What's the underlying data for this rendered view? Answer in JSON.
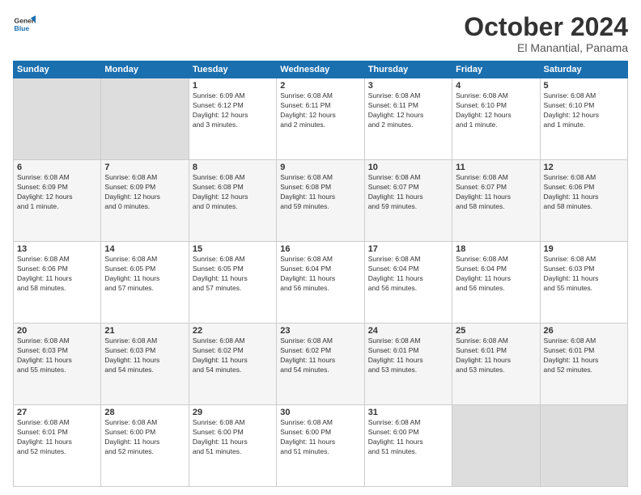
{
  "header": {
    "logo_line1": "General",
    "logo_line2": "Blue",
    "month_title": "October 2024",
    "location": "El Manantial, Panama"
  },
  "calendar": {
    "weekdays": [
      "Sunday",
      "Monday",
      "Tuesday",
      "Wednesday",
      "Thursday",
      "Friday",
      "Saturday"
    ],
    "weeks": [
      [
        {
          "num": "",
          "empty": true
        },
        {
          "num": "",
          "empty": true
        },
        {
          "num": "1",
          "info": "Sunrise: 6:09 AM\nSunset: 6:12 PM\nDaylight: 12 hours\nand 3 minutes."
        },
        {
          "num": "2",
          "info": "Sunrise: 6:08 AM\nSunset: 6:11 PM\nDaylight: 12 hours\nand 2 minutes."
        },
        {
          "num": "3",
          "info": "Sunrise: 6:08 AM\nSunset: 6:11 PM\nDaylight: 12 hours\nand 2 minutes."
        },
        {
          "num": "4",
          "info": "Sunrise: 6:08 AM\nSunset: 6:10 PM\nDaylight: 12 hours\nand 1 minute."
        },
        {
          "num": "5",
          "info": "Sunrise: 6:08 AM\nSunset: 6:10 PM\nDaylight: 12 hours\nand 1 minute."
        }
      ],
      [
        {
          "num": "6",
          "info": "Sunrise: 6:08 AM\nSunset: 6:09 PM\nDaylight: 12 hours\nand 1 minute."
        },
        {
          "num": "7",
          "info": "Sunrise: 6:08 AM\nSunset: 6:09 PM\nDaylight: 12 hours\nand 0 minutes."
        },
        {
          "num": "8",
          "info": "Sunrise: 6:08 AM\nSunset: 6:08 PM\nDaylight: 12 hours\nand 0 minutes."
        },
        {
          "num": "9",
          "info": "Sunrise: 6:08 AM\nSunset: 6:08 PM\nDaylight: 11 hours\nand 59 minutes."
        },
        {
          "num": "10",
          "info": "Sunrise: 6:08 AM\nSunset: 6:07 PM\nDaylight: 11 hours\nand 59 minutes."
        },
        {
          "num": "11",
          "info": "Sunrise: 6:08 AM\nSunset: 6:07 PM\nDaylight: 11 hours\nand 58 minutes."
        },
        {
          "num": "12",
          "info": "Sunrise: 6:08 AM\nSunset: 6:06 PM\nDaylight: 11 hours\nand 58 minutes."
        }
      ],
      [
        {
          "num": "13",
          "info": "Sunrise: 6:08 AM\nSunset: 6:06 PM\nDaylight: 11 hours\nand 58 minutes."
        },
        {
          "num": "14",
          "info": "Sunrise: 6:08 AM\nSunset: 6:05 PM\nDaylight: 11 hours\nand 57 minutes."
        },
        {
          "num": "15",
          "info": "Sunrise: 6:08 AM\nSunset: 6:05 PM\nDaylight: 11 hours\nand 57 minutes."
        },
        {
          "num": "16",
          "info": "Sunrise: 6:08 AM\nSunset: 6:04 PM\nDaylight: 11 hours\nand 56 minutes."
        },
        {
          "num": "17",
          "info": "Sunrise: 6:08 AM\nSunset: 6:04 PM\nDaylight: 11 hours\nand 56 minutes."
        },
        {
          "num": "18",
          "info": "Sunrise: 6:08 AM\nSunset: 6:04 PM\nDaylight: 11 hours\nand 56 minutes."
        },
        {
          "num": "19",
          "info": "Sunrise: 6:08 AM\nSunset: 6:03 PM\nDaylight: 11 hours\nand 55 minutes."
        }
      ],
      [
        {
          "num": "20",
          "info": "Sunrise: 6:08 AM\nSunset: 6:03 PM\nDaylight: 11 hours\nand 55 minutes."
        },
        {
          "num": "21",
          "info": "Sunrise: 6:08 AM\nSunset: 6:03 PM\nDaylight: 11 hours\nand 54 minutes."
        },
        {
          "num": "22",
          "info": "Sunrise: 6:08 AM\nSunset: 6:02 PM\nDaylight: 11 hours\nand 54 minutes."
        },
        {
          "num": "23",
          "info": "Sunrise: 6:08 AM\nSunset: 6:02 PM\nDaylight: 11 hours\nand 54 minutes."
        },
        {
          "num": "24",
          "info": "Sunrise: 6:08 AM\nSunset: 6:01 PM\nDaylight: 11 hours\nand 53 minutes."
        },
        {
          "num": "25",
          "info": "Sunrise: 6:08 AM\nSunset: 6:01 PM\nDaylight: 11 hours\nand 53 minutes."
        },
        {
          "num": "26",
          "info": "Sunrise: 6:08 AM\nSunset: 6:01 PM\nDaylight: 11 hours\nand 52 minutes."
        }
      ],
      [
        {
          "num": "27",
          "info": "Sunrise: 6:08 AM\nSunset: 6:01 PM\nDaylight: 11 hours\nand 52 minutes."
        },
        {
          "num": "28",
          "info": "Sunrise: 6:08 AM\nSunset: 6:00 PM\nDaylight: 11 hours\nand 52 minutes."
        },
        {
          "num": "29",
          "info": "Sunrise: 6:08 AM\nSunset: 6:00 PM\nDaylight: 11 hours\nand 51 minutes."
        },
        {
          "num": "30",
          "info": "Sunrise: 6:08 AM\nSunset: 6:00 PM\nDaylight: 11 hours\nand 51 minutes."
        },
        {
          "num": "31",
          "info": "Sunrise: 6:08 AM\nSunset: 6:00 PM\nDaylight: 11 hours\nand 51 minutes."
        },
        {
          "num": "",
          "empty": true
        },
        {
          "num": "",
          "empty": true
        }
      ]
    ]
  }
}
